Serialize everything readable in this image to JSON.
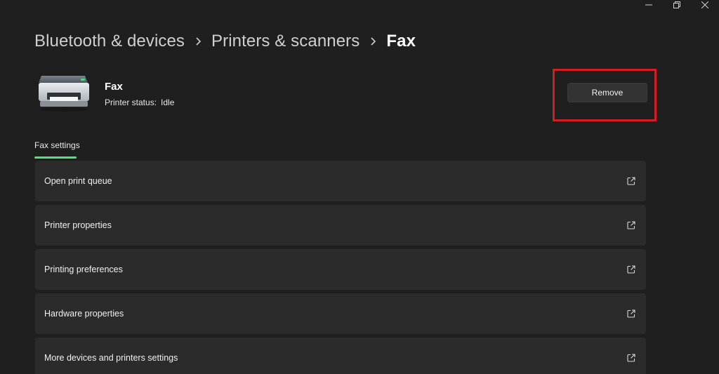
{
  "window": {
    "controls": [
      {
        "name": "minimize-icon"
      },
      {
        "name": "restore-icon"
      },
      {
        "name": "close-icon"
      }
    ]
  },
  "breadcrumb": {
    "items": [
      "Bluetooth & devices",
      "Printers & scanners",
      "Fax"
    ],
    "separator_icon": "chevron-right-icon"
  },
  "device": {
    "icon": "printer-icon",
    "name": "Fax",
    "status_label": "Printer status:",
    "status_value": "Idle"
  },
  "actions": {
    "remove_label": "Remove",
    "highlight_color": "#d41e24"
  },
  "tabs": {
    "active_label": "Fax settings",
    "accent_color": "#57e08a"
  },
  "settings": {
    "rows": [
      {
        "label": "Open print queue",
        "icon": "external-link-icon"
      },
      {
        "label": "Printer properties",
        "icon": "external-link-icon"
      },
      {
        "label": "Printing preferences",
        "icon": "external-link-icon"
      },
      {
        "label": "Hardware properties",
        "icon": "external-link-icon"
      },
      {
        "label": "More devices and printers settings",
        "icon": "external-link-icon"
      }
    ]
  }
}
